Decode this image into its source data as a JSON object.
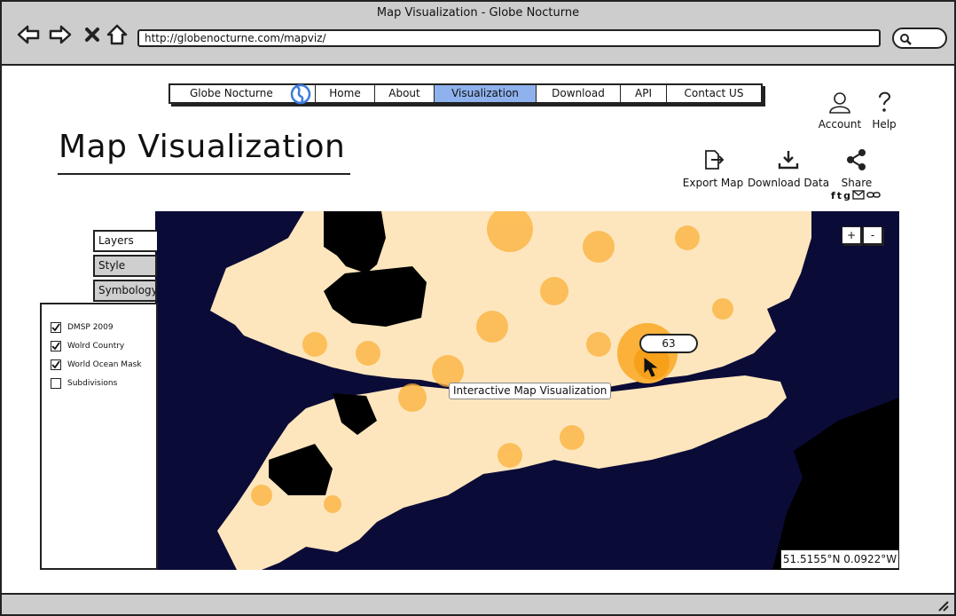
{
  "window": {
    "title": "Map Visualization - Globe Nocturne"
  },
  "browser": {
    "url": "http://globenocturne.com/mapviz/",
    "back_icon": "arrow-left-icon",
    "forward_icon": "arrow-right-icon",
    "stop_icon": "close-icon",
    "home_icon": "home-icon"
  },
  "menu": {
    "items": [
      {
        "label": "Globe Nocturne"
      },
      {
        "label": "Home"
      },
      {
        "label": "About"
      },
      {
        "label": "Visualization"
      },
      {
        "label": "Download"
      },
      {
        "label": "API"
      },
      {
        "label": "Contact US"
      }
    ],
    "active": "Visualization",
    "active_color": "#8fb2ee"
  },
  "top_actions": {
    "account": "Account",
    "help": "Help"
  },
  "page": {
    "title": "Map Visualization"
  },
  "tools": {
    "export": "Export Map",
    "download": "Download Data",
    "share": "Share"
  },
  "social": [
    "f",
    "t",
    "g",
    "mail",
    "link"
  ],
  "tabs": [
    {
      "label": "Layers",
      "active": true
    },
    {
      "label": "Style",
      "active": false
    },
    {
      "label": "Symbology",
      "active": false
    }
  ],
  "layers": [
    {
      "label": "DMSP 2009",
      "checked": true
    },
    {
      "label": "Wolrd Country",
      "checked": true
    },
    {
      "label": "World Ocean Mask",
      "checked": true
    },
    {
      "label": "Subdivisions",
      "checked": false
    }
  ],
  "map": {
    "zoom_in": "+",
    "zoom_out": "-",
    "label": "Interactive Map Visualization",
    "bubble_value": "63",
    "coordinates": "51.5155°N 0.0922°W",
    "colors": {
      "ocean": "#0b0b38",
      "land": "#fde6bd",
      "light": "#fbb13a",
      "dark": "#000000"
    }
  }
}
